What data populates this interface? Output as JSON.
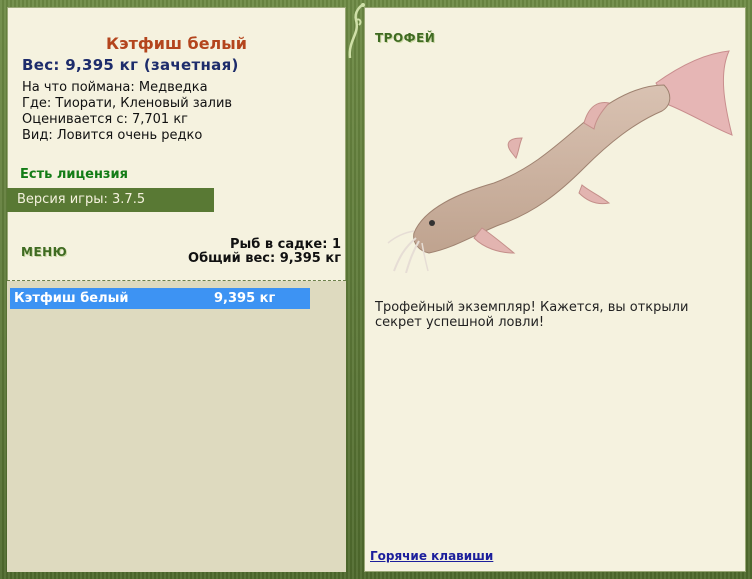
{
  "fish": {
    "title": "Кэтфиш белый",
    "weight_line": "Вес: 9,395 кг (зачетная)",
    "info": [
      "На что поймана: Медведка",
      "Где: Тиорати, Кленовый залив",
      "Оценивается с: 7,701 кг",
      "Вид: Ловится очень редко"
    ]
  },
  "license": "Есть лицензия",
  "version": "Версия игры: 3.7.5",
  "menu_label": "МЕНЮ",
  "keepnet": {
    "count_line": "Рыб в садке: 1",
    "total_line": "Общий вес: 9,395 кг",
    "items": [
      {
        "name": "Кэтфиш белый",
        "weight": "9,395 кг"
      }
    ]
  },
  "trophy": {
    "heading": "ТРОФЕЙ",
    "text": "Трофейный экземпляр! Кажется, вы открыли секрет успешной ловли!"
  },
  "hotkeys_label": "Горячие клавиши",
  "colors": {
    "frame": "#5f7a3a",
    "panel": "#f5f2df",
    "title": "#b4451d",
    "weight": "#1d2c6b",
    "license": "#137c16",
    "selection": "#3d93f3"
  }
}
